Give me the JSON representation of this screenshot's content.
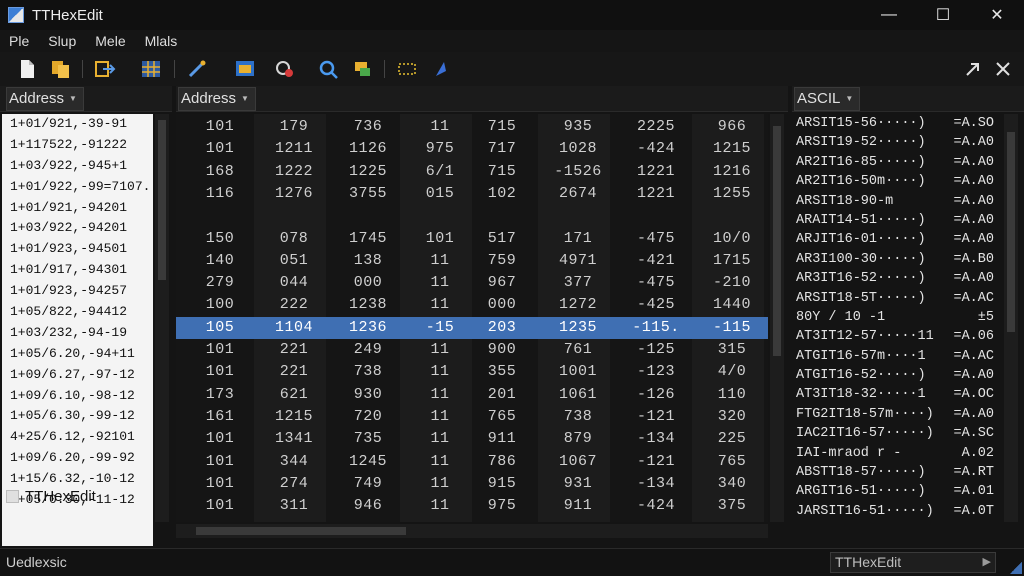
{
  "window": {
    "title": "TTHexEdit",
    "controls": [
      "—",
      "☐",
      "✕"
    ]
  },
  "menu": [
    "Ple",
    "Slup",
    "Mele",
    "Mlals"
  ],
  "left_pane": {
    "header": "Address",
    "rows": [
      "1+01/921,-39-91",
      "1+117522,-91222",
      "1+03/922,-945+1",
      "1+01/922,-99=7107.",
      "1+01/921,-94201",
      "1+03/922,-94201",
      "1+01/923,-94501",
      "1+01/917,-94301",
      "1+01/923,-94257",
      "1+05/822,-94412",
      "1+03/232,-94-19",
      "1+05/6.20,-94+11",
      "1+09/6.27,-97-12",
      "1+09/6.10,-98-12",
      "1+05/6.30,-99-12",
      "4+25/6.12,-92101",
      "1+09/6.20,-99-92",
      "1+15/6.32,-10-12",
      "1+05/0:30,-11-12"
    ],
    "footer": "TTHexEdit"
  },
  "center_pane": {
    "header": "Address",
    "rows": [
      [
        "101",
        "179",
        "736",
        "11",
        "715",
        "935",
        "2225",
        "966"
      ],
      [
        "101",
        "1211",
        "1126",
        "975",
        "717",
        "1028",
        "-424",
        "1215"
      ],
      [
        "168",
        "1222",
        "1225",
        "6/1",
        "715",
        "-1526",
        "1221",
        "1216"
      ],
      [
        "116",
        "1276",
        "3755",
        "015",
        "102",
        "2674",
        "1221",
        "1255"
      ],
      [
        "",
        "",
        "",
        "",
        "",
        "",
        "",
        ""
      ],
      [
        "150",
        "078",
        "1745",
        "101",
        "517",
        "171",
        "-475",
        "10/0"
      ],
      [
        "140",
        "051",
        "138",
        "11",
        "759",
        "4971",
        "-421",
        "1715"
      ],
      [
        "279",
        "044",
        "000",
        "11",
        "967",
        "377",
        "-475",
        "-210"
      ],
      [
        "100",
        "222",
        "1238",
        "11",
        "000",
        "1272",
        "-425",
        "1440"
      ],
      [
        "105",
        "1104",
        "1236",
        "-15",
        "203",
        "1235",
        "-115.",
        "-115"
      ],
      [
        "101",
        "221",
        "249",
        "11",
        "900",
        "761",
        "-125",
        "315"
      ],
      [
        "101",
        "221",
        "738",
        "11",
        "355",
        "1001",
        "-123",
        "4/0"
      ],
      [
        "173",
        "621",
        "930",
        "11",
        "201",
        "1061",
        "-126",
        "110"
      ],
      [
        "161",
        "1215",
        "720",
        "11",
        "765",
        "738",
        "-121",
        "320"
      ],
      [
        "101",
        "1341",
        "735",
        "11",
        "911",
        "879",
        "-134",
        "225"
      ],
      [
        "101",
        "344",
        "1245",
        "11",
        "786",
        "1067",
        "-121",
        "765"
      ],
      [
        "101",
        "274",
        "749",
        "11",
        "915",
        "931",
        "-134",
        "340"
      ],
      [
        "101",
        "311",
        "946",
        "11",
        "975",
        "911",
        "-424",
        "375"
      ]
    ],
    "selected_row": 9
  },
  "right_pane": {
    "header": "ASCIL",
    "rows": [
      [
        "ARSIT15-56·····)",
        "=A.SO"
      ],
      [
        "ARSIT19-52·····)",
        "=A.A0"
      ],
      [
        "AR2IT16-85·····)",
        "=A.A0"
      ],
      [
        "AR2IT16-50m····)",
        "=A.A0"
      ],
      [
        "ARSIT18-90-m",
        "=A.A0"
      ],
      [
        "ARAIT14-51·····)",
        "=A.A0"
      ],
      [
        "ARJIT16-01·····)",
        "=A.A0"
      ],
      [
        "AR3I100-30·····)",
        "=A.B0"
      ],
      [
        "AR3IT16-52·····)",
        "=A.A0"
      ],
      [
        "ARSIT18-5T·····)",
        "=A.AC"
      ],
      [
        "80Y / 10 -1",
        "±5"
      ],
      [
        "AT3IT12-57·····11",
        "=A.06"
      ],
      [
        "ATGIT16-57m····1",
        "=A.AC"
      ],
      [
        "ATGIT16-52·····)",
        "=A.A0"
      ],
      [
        "AT3IT18-32·····1",
        "=A.OC"
      ],
      [
        "FTG2IT18-57m····)",
        "=A.A0"
      ],
      [
        "IAC2IT16-57·····)",
        "=A.SC"
      ],
      [
        "IAI-mraod  r  -",
        "A.02"
      ],
      [
        "ABSTT18-57·····)",
        "=A.RT"
      ],
      [
        "ARGIT16-51·····)",
        "=A.01"
      ],
      [
        "JARSIT16-51·····)",
        "=A.0T"
      ]
    ]
  },
  "status": {
    "left": "Uedlexsic",
    "field": "TTHexEdit"
  },
  "colors": {
    "selection": "#3f6fb3",
    "background": "#141414"
  }
}
